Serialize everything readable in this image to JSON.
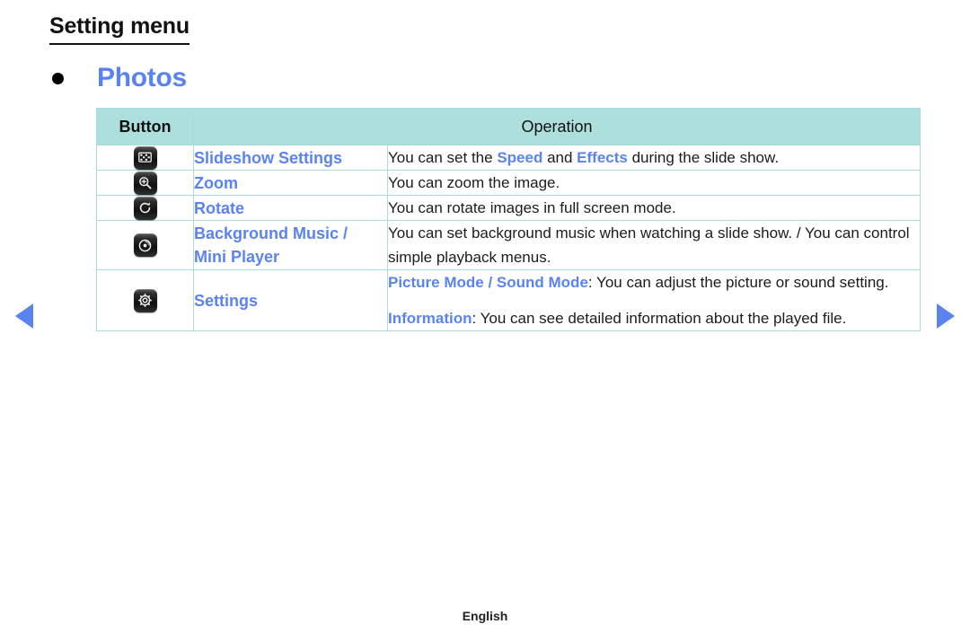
{
  "page": {
    "title": "Setting menu",
    "section_heading": "Photos",
    "footer_language": "English",
    "accent_blue": "#5b83ef",
    "header_fill": "#ade0dc",
    "border_color": "#a9dcda"
  },
  "nav": {
    "prev_icon": "triangle-left-icon",
    "next_icon": "triangle-right-icon"
  },
  "table": {
    "headers": {
      "button": "Button",
      "operation": "Operation"
    },
    "rows": [
      {
        "icon": "slideshow-settings-icon",
        "name": "Slideshow Settings",
        "operation_paragraphs": [
          [
            {
              "t": "You can set the ",
              "hl": false
            },
            {
              "t": "Speed",
              "hl": true
            },
            {
              "t": " and ",
              "hl": false
            },
            {
              "t": "Effects",
              "hl": true
            },
            {
              "t": " during the slide show.",
              "hl": false
            }
          ]
        ]
      },
      {
        "icon": "zoom-icon",
        "name": "Zoom",
        "operation_paragraphs": [
          [
            {
              "t": "You can zoom the image.",
              "hl": false
            }
          ]
        ]
      },
      {
        "icon": "rotate-icon",
        "name": "Rotate",
        "operation_paragraphs": [
          [
            {
              "t": "You can rotate images in full screen mode.",
              "hl": false
            }
          ]
        ]
      },
      {
        "icon": "background-music-icon",
        "name": "Background Music /\nMini Player",
        "operation_paragraphs": [
          [
            {
              "t": "You can set background music when watching a slide show. / You can control simple playback menus.",
              "hl": false
            }
          ]
        ]
      },
      {
        "icon": "settings-gear-icon",
        "name": "Settings",
        "operation_paragraphs": [
          [
            {
              "t": "Picture Mode / Sound Mode",
              "hl": true
            },
            {
              "t": ": You can adjust the picture or sound setting.",
              "hl": false
            }
          ],
          [
            {
              "t": "Information",
              "hl": true
            },
            {
              "t": ": You can see detailed information about the played file.",
              "hl": false
            }
          ]
        ]
      }
    ]
  }
}
